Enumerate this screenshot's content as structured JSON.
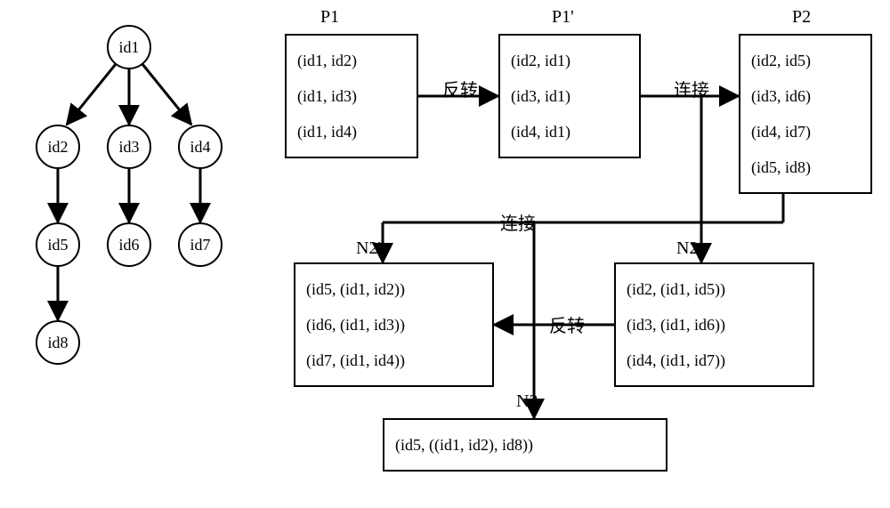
{
  "tree": {
    "n1": "id1",
    "n2": "id2",
    "n3": "id3",
    "n4": "id4",
    "n5": "id5",
    "n6": "id6",
    "n7": "id7",
    "n8": "id8"
  },
  "labels": {
    "P1": "P1",
    "P1p": "P1'",
    "P2": "P2",
    "N2p": "N2'",
    "N2": "N2",
    "N3": "N3"
  },
  "boxes": {
    "P1": {
      "r0": "(id1, id2)",
      "r1": "(id1, id3)",
      "r2": "(id1, id4)"
    },
    "P1p": {
      "r0": "(id2, id1)",
      "r1": "(id3, id1)",
      "r2": "(id4, id1)"
    },
    "P2": {
      "r0": "(id2, id5)",
      "r1": "(id3, id6)",
      "r2": "(id4, id7)",
      "r3": "(id5, id8)"
    },
    "N2p": {
      "r0": "(id5, (id1, id2))",
      "r1": "(id6, (id1, id3))",
      "r2": "(id7, (id1, id4))"
    },
    "N2": {
      "r0": "(id2, (id1, id5))",
      "r1": "(id3, (id1, id6))",
      "r2": "(id4, (id1, id7))"
    },
    "N3": {
      "r0": "(id5, ((id1, id2), id8))"
    }
  },
  "edgeLabels": {
    "rev1": "反转",
    "con1": "连接",
    "con2": "连接",
    "rev2": "反转"
  }
}
